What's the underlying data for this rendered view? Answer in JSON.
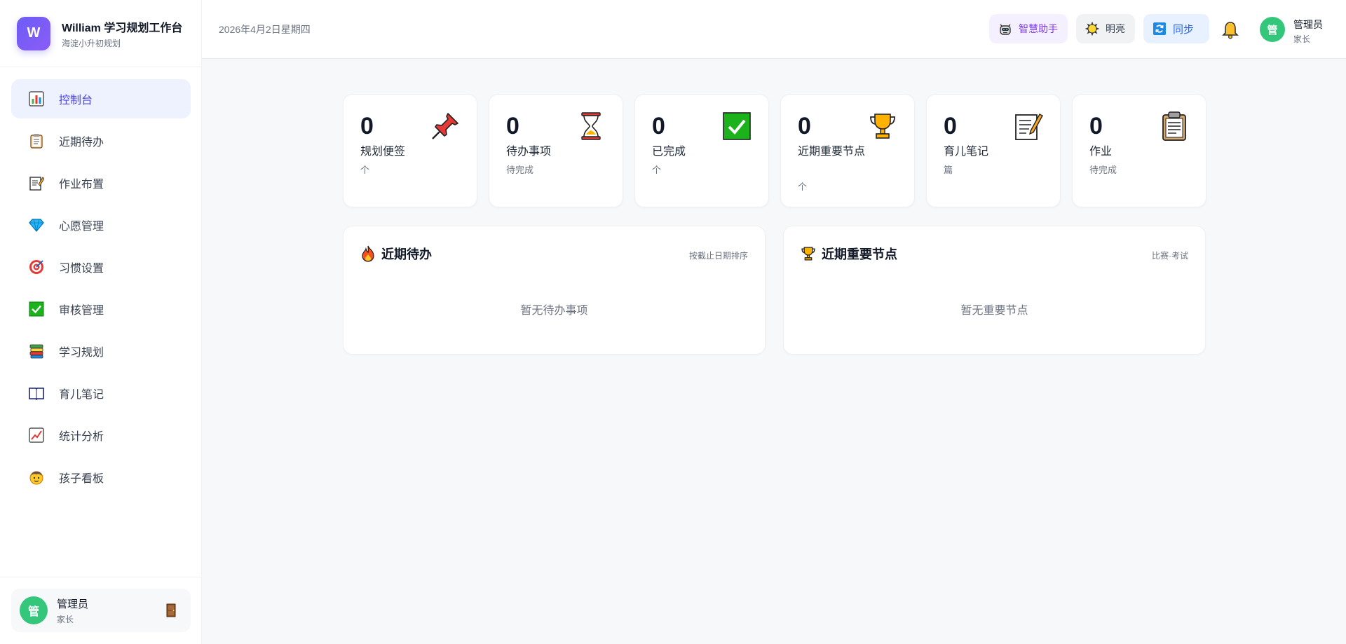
{
  "brand": {
    "logo_letter": "W",
    "title": "William 学习规划工作台",
    "subtitle": "海淀小升初规划"
  },
  "sidebar": {
    "items": [
      {
        "label": "控制台",
        "icon": "bar-chart-icon",
        "active": true
      },
      {
        "label": "近期待办",
        "icon": "clipboard-icon"
      },
      {
        "label": "作业布置",
        "icon": "memo-icon"
      },
      {
        "label": "心愿管理",
        "icon": "gem-icon"
      },
      {
        "label": "习惯设置",
        "icon": "target-icon"
      },
      {
        "label": "审核管理",
        "icon": "check-box-icon"
      },
      {
        "label": "学习规划",
        "icon": "books-icon"
      },
      {
        "label": "育儿笔记",
        "icon": "book-icon"
      },
      {
        "label": "统计分析",
        "icon": "trend-chart-icon"
      },
      {
        "label": "孩子看板",
        "icon": "child-face-icon"
      }
    ]
  },
  "footer_user": {
    "avatar_text": "管",
    "name": "管理员",
    "role": "家长",
    "logout_icon": "door-icon"
  },
  "header": {
    "date": "2026年4月2日星期四",
    "ai_button": "智慧助手",
    "theme_button": "明亮",
    "sync_button": "同步",
    "bell_icon": "bell-icon",
    "avatar_text": "管",
    "user_name": "管理员",
    "user_role": "家长"
  },
  "stats": [
    {
      "value": "0",
      "label": "规划便签",
      "unit": "个",
      "icon": "pushpin-icon"
    },
    {
      "value": "0",
      "label": "待办事项",
      "unit": "待完成",
      "icon": "hourglass-icon"
    },
    {
      "value": "0",
      "label": "已完成",
      "unit": "个",
      "icon": "check-mark-icon"
    },
    {
      "value": "0",
      "label": "近期重要节点",
      "unit": "个",
      "icon": "trophy-icon"
    },
    {
      "value": "0",
      "label": "育儿笔记",
      "unit": "篇",
      "icon": "memo-icon"
    },
    {
      "value": "0",
      "label": "作业",
      "unit": "待完成",
      "icon": "clipboard-icon"
    }
  ],
  "panels": {
    "todo": {
      "title": "近期待办",
      "hint": "按截止日期排序",
      "empty": "暂无待办事项",
      "icon": "fire-icon"
    },
    "milestones": {
      "title": "近期重要节点",
      "hint": "比赛·考试",
      "empty": "暂无重要节点",
      "icon": "trophy-icon"
    }
  },
  "colors": {
    "accent": "#4f46e5",
    "active_bg": "#eef2ff",
    "avatar_green": "#34c77b",
    "logo_purple": "#7c5cf5"
  }
}
